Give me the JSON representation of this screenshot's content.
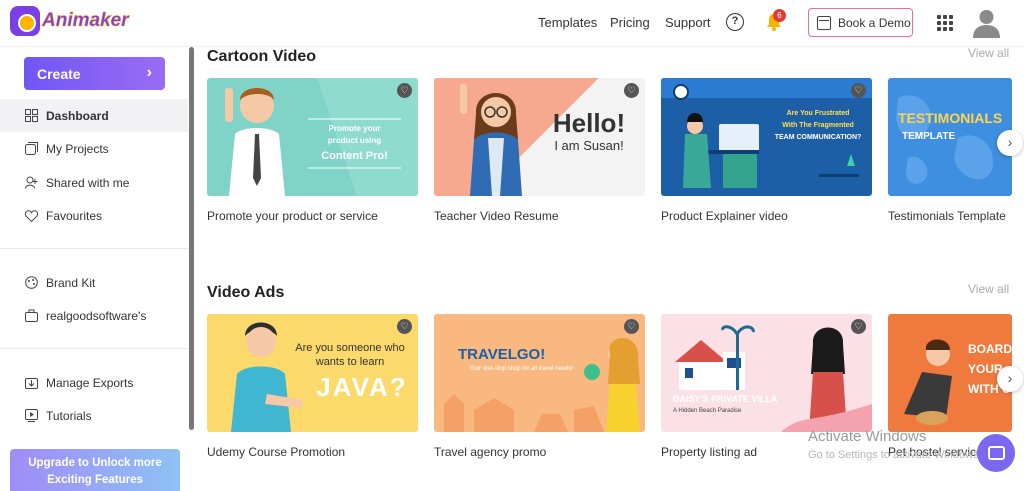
{
  "header": {
    "logo_text": "Animaker",
    "nav": [
      "Templates",
      "Pricing",
      "Support"
    ],
    "help_label": "?",
    "notifications_count": "6",
    "demo_label": "Book a Demo"
  },
  "sidebar": {
    "create_label": "Create",
    "items": [
      {
        "label": "Dashboard",
        "icon": "dashboard-icon"
      },
      {
        "label": "My Projects",
        "icon": "projects-icon"
      },
      {
        "label": "Shared with me",
        "icon": "shared-icon"
      },
      {
        "label": "Favourites",
        "icon": "heart-icon"
      },
      {
        "label": "Brand Kit",
        "icon": "brand-kit-icon"
      },
      {
        "label": "realgoodsoftware's",
        "icon": "workspace-icon"
      },
      {
        "label": "Manage Exports",
        "icon": "exports-icon"
      },
      {
        "label": "Tutorials",
        "icon": "tutorials-icon"
      }
    ],
    "upgrade_line1": "Upgrade to Unlock more",
    "upgrade_line2": "Exciting Features"
  },
  "sections": [
    {
      "title": "Cartoon Video",
      "view_all": "View all",
      "cards": [
        {
          "label": "Promote your product or service",
          "art_lines": [
            "Promote your",
            "product using",
            "Content Pro!"
          ]
        },
        {
          "label": "Teacher Video Resume",
          "art_lines": [
            "Hello!",
            "I am Susan!"
          ]
        },
        {
          "label": "Product Explainer video",
          "art_lines": [
            "Are You Frustrated",
            "With The Fragmented",
            "TEAM COMMUNICATION?"
          ]
        },
        {
          "label": "Testimonials Template",
          "art_lines": [
            "TESTIMONIALS",
            "TEMPLATE"
          ]
        }
      ]
    },
    {
      "title": "Video Ads",
      "view_all": "View all",
      "cards": [
        {
          "label": "Udemy Course Promotion",
          "art_lines": [
            "Are you someone who",
            "wants to learn",
            "JAVA?"
          ]
        },
        {
          "label": "Travel agency promo",
          "art_lines": [
            "TRAVELGO!",
            "Your one-stop shop for all travel needs!"
          ]
        },
        {
          "label": "Property listing ad",
          "art_lines": [
            "DAISY'S PRIVATE VILLA",
            "A Hidden Beach Paradise"
          ]
        },
        {
          "label": "Pet hostel service",
          "art_lines": [
            "BOARD",
            "YOUR",
            "WITH U"
          ]
        }
      ]
    }
  ],
  "overlay": {
    "watermark_title": "Activate Windows",
    "watermark_sub": "Go to Settings to activate Windows."
  },
  "colors": {
    "brand": "#7b3fe4",
    "create_start": "#7057f5",
    "demo_border": "#f06b8f",
    "badge": "#e53935"
  }
}
